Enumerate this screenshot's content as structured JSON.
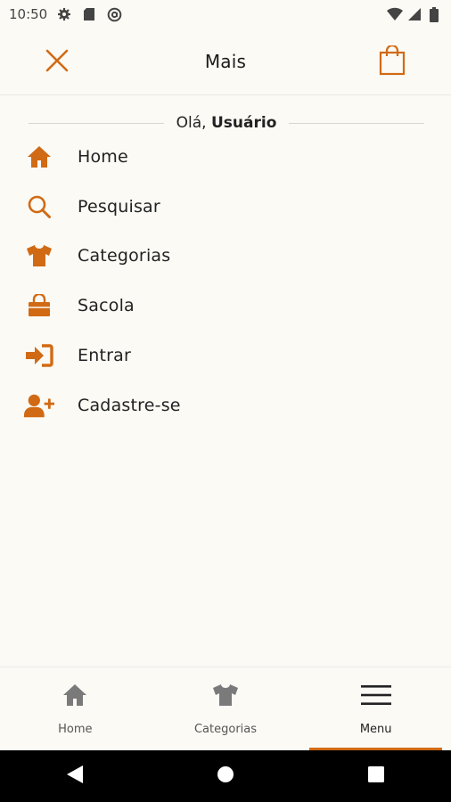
{
  "status_bar": {
    "time": "10:50",
    "icons": [
      "gear-icon",
      "sd-card-icon",
      "at-sign-icon",
      "wifi-icon",
      "signal-icon",
      "battery-icon"
    ]
  },
  "app_bar": {
    "title": "Mais",
    "close_icon": "close-icon",
    "bag_icon": "shopping-bag-icon"
  },
  "greeting": {
    "prefix": "Olá, ",
    "user": "Usuário"
  },
  "menu": {
    "items": [
      {
        "label": "Home",
        "icon": "home-icon"
      },
      {
        "label": "Pesquisar",
        "icon": "search-icon"
      },
      {
        "label": "Categorias",
        "icon": "tshirt-icon"
      },
      {
        "label": "Sacola",
        "icon": "bag-icon"
      },
      {
        "label": "Entrar",
        "icon": "sign-in-icon"
      },
      {
        "label": "Cadastre-se",
        "icon": "user-plus-icon"
      }
    ]
  },
  "bottom_nav": {
    "items": [
      {
        "label": "Home",
        "icon": "home-icon",
        "active": false
      },
      {
        "label": "Categorias",
        "icon": "tshirt-icon",
        "active": false
      },
      {
        "label": "Menu",
        "icon": "hamburger-menu-icon",
        "active": true
      }
    ]
  },
  "colors": {
    "accent": "#d16a14",
    "background": "#fbfaf5",
    "nav_icon_inactive": "#7a7a7a"
  }
}
